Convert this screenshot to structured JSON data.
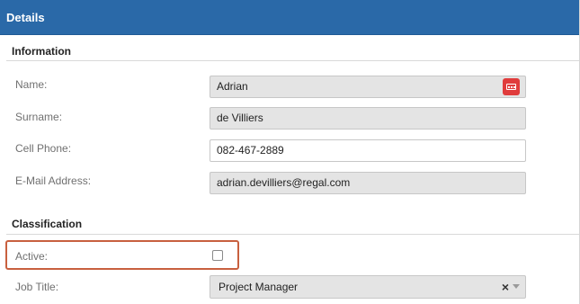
{
  "header": {
    "title": "Details"
  },
  "sections": {
    "information": {
      "title": "Information"
    },
    "classification": {
      "title": "Classification"
    }
  },
  "fields": {
    "name": {
      "label": "Name:",
      "value": "Adrian"
    },
    "surname": {
      "label": "Surname:",
      "value": "de Villiers"
    },
    "cell_phone": {
      "label": "Cell Phone:",
      "value": "082-467-2889"
    },
    "email": {
      "label": "E-Mail Address:",
      "value": "adrian.devilliers@regal.com"
    },
    "active": {
      "label": "Active:",
      "checked": false
    },
    "job_title": {
      "label": "Job Title:",
      "value": "Project Manager",
      "clear_glyph": "×"
    }
  },
  "colors": {
    "header_bg": "#2a69a8",
    "highlight_border": "#c8603f",
    "menu_button": "#e03c3c",
    "readonly_field_bg": "#e4e4e4"
  },
  "icons": {
    "name_menu": "ellipsis-menu-icon",
    "job_clear": "clear-icon",
    "job_dropdown": "chevron-down-icon"
  }
}
